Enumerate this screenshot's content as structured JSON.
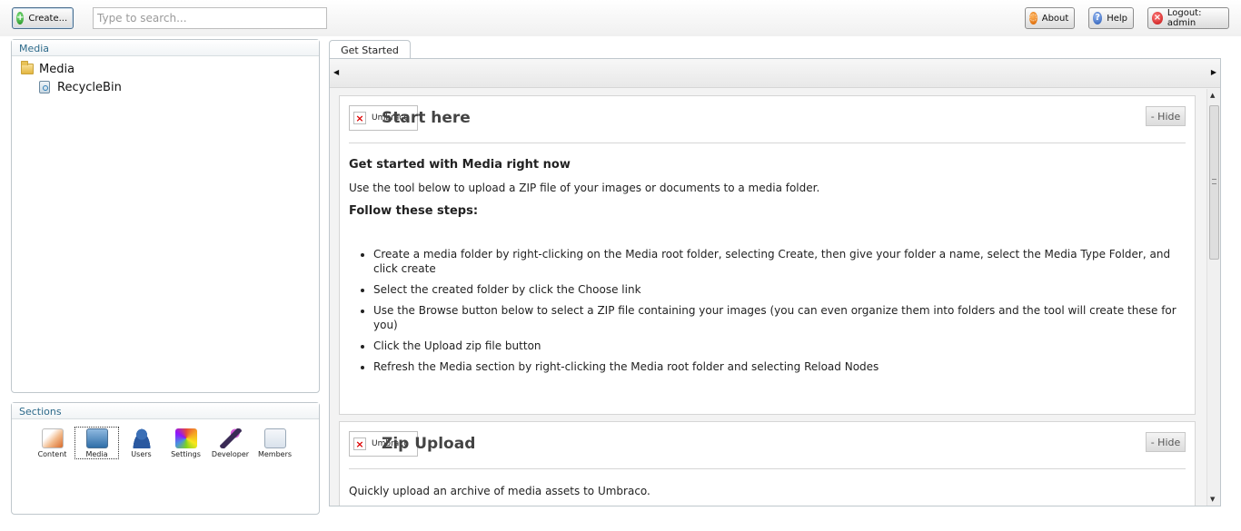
{
  "topbar": {
    "create_label": "Create...",
    "search_placeholder": "Type to search...",
    "about_label": "About",
    "help_label": "Help",
    "logout_label": "Logout: admin"
  },
  "media_panel": {
    "title": "Media",
    "tree": [
      {
        "label": "Media",
        "icon": "folder-icon"
      },
      {
        "label": "RecycleBin",
        "icon": "recycle-bin-icon"
      }
    ]
  },
  "sections_panel": {
    "title": "Sections",
    "items": [
      {
        "label": "Content",
        "icon": "content-icon"
      },
      {
        "label": "Media",
        "icon": "media-icon",
        "active": true
      },
      {
        "label": "Users",
        "icon": "users-icon"
      },
      {
        "label": "Settings",
        "icon": "settings-icon"
      },
      {
        "label": "Developer",
        "icon": "developer-icon"
      },
      {
        "label": "Members",
        "icon": "members-icon"
      }
    ]
  },
  "tabs": [
    {
      "label": "Get Started"
    }
  ],
  "dashboard": {
    "start_box": {
      "image_alt": "Umbraco",
      "title": "Start here",
      "hide_label": "- Hide",
      "heading": "Get started with Media right now",
      "intro": "Use the tool below to upload a ZIP file of your images or documents to a media folder.",
      "steps_heading": "Follow these steps:",
      "steps": [
        "Create a media folder by right-clicking on the Media root folder, selecting Create, then give your folder a name, select the Media Type Folder, and click create",
        "Select the created folder by click the Choose link",
        "Use the Browse button below to select a ZIP file containing your images (you can even organize them into folders and the tool will create these for you)",
        "Click the Upload zip file button",
        "Refresh the Media section by right-clicking the Media root folder and selecting Reload Nodes"
      ]
    },
    "zip_box": {
      "image_alt": "Umbraco",
      "title": "Zip Upload",
      "hide_label": "- Hide",
      "text": "Quickly upload an archive of media assets to Umbraco."
    }
  },
  "colors": {
    "panel_title": "#2d6a8a",
    "panel_border": "#bfc7cc"
  }
}
